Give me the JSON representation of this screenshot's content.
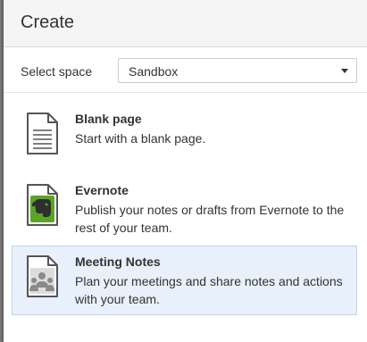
{
  "dialog": {
    "title": "Create"
  },
  "space": {
    "label": "Select space",
    "selected": "Sandbox"
  },
  "blueprints": [
    {
      "title": "Blank page",
      "description": "Start with a blank page.",
      "icon": "blank-page-icon",
      "selected": false
    },
    {
      "title": "Evernote",
      "description": "Publish your notes or drafts from Evernote to the rest of your team.",
      "icon": "evernote-icon",
      "selected": false
    },
    {
      "title": "Meeting Notes",
      "description": "Plan your meetings and share notes and actions with your team.",
      "icon": "meeting-notes-icon",
      "selected": true
    }
  ],
  "colors": {
    "selected_background": "#e8f0fb",
    "evernote_green": "#5aa426"
  }
}
